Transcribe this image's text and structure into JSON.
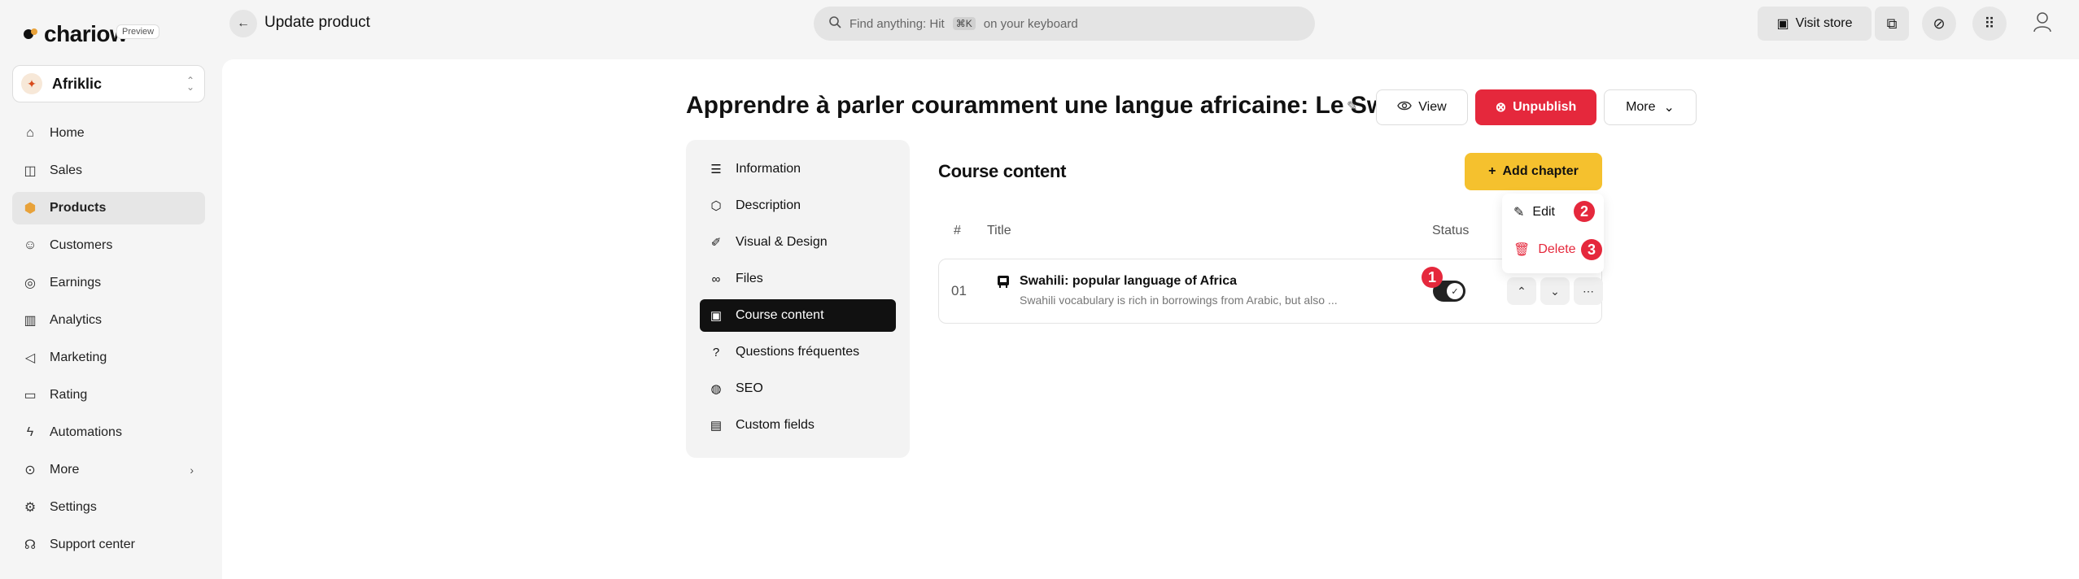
{
  "topbar": {
    "logo_text": "chariow",
    "preview_label": "Preview",
    "page_heading": "Update product",
    "search_prefix": "Find anything: Hit",
    "search_kbd": "⌘K",
    "search_suffix": "on your keyboard",
    "visit_store_label": "Visit store"
  },
  "sidebar": {
    "store_name": "Afriklic",
    "items": [
      {
        "label": "Home"
      },
      {
        "label": "Sales"
      },
      {
        "label": "Products"
      },
      {
        "label": "Customers"
      },
      {
        "label": "Earnings"
      },
      {
        "label": "Analytics"
      },
      {
        "label": "Marketing"
      },
      {
        "label": "Rating"
      },
      {
        "label": "Automations"
      },
      {
        "label": "More"
      },
      {
        "label": "Settings"
      },
      {
        "label": "Support center"
      }
    ],
    "active_item": "Products"
  },
  "product": {
    "title": "Apprendre à parler couramment une langue africaine: Le Swahili",
    "view_label": "View",
    "unpublish_label": "Unpublish",
    "more_label": "More"
  },
  "settings_menu": {
    "items": [
      {
        "label": "Information"
      },
      {
        "label": "Description"
      },
      {
        "label": "Visual & Design"
      },
      {
        "label": "Files"
      },
      {
        "label": "Course content"
      },
      {
        "label": "Questions fréquentes"
      },
      {
        "label": "SEO"
      },
      {
        "label": "Custom fields"
      }
    ],
    "active_item": "Course content"
  },
  "course_content": {
    "title": "Course content",
    "add_chapter_label": "Add chapter",
    "columns": {
      "num": "#",
      "title": "Title",
      "status": "Status"
    },
    "rows": [
      {
        "num": "01",
        "title": "Swahili: popular language of Africa",
        "description": "Swahili vocabulary is rich in borrowings from Arabic, but also ...",
        "published": true
      }
    ]
  },
  "dropdown": {
    "edit_label": "Edit",
    "delete_label": "Delete"
  },
  "markers": [
    "1",
    "2",
    "3"
  ],
  "colors": {
    "accent_yellow": "#f5c12e",
    "danger_red": "#e5283c",
    "active_dark": "#111111"
  }
}
